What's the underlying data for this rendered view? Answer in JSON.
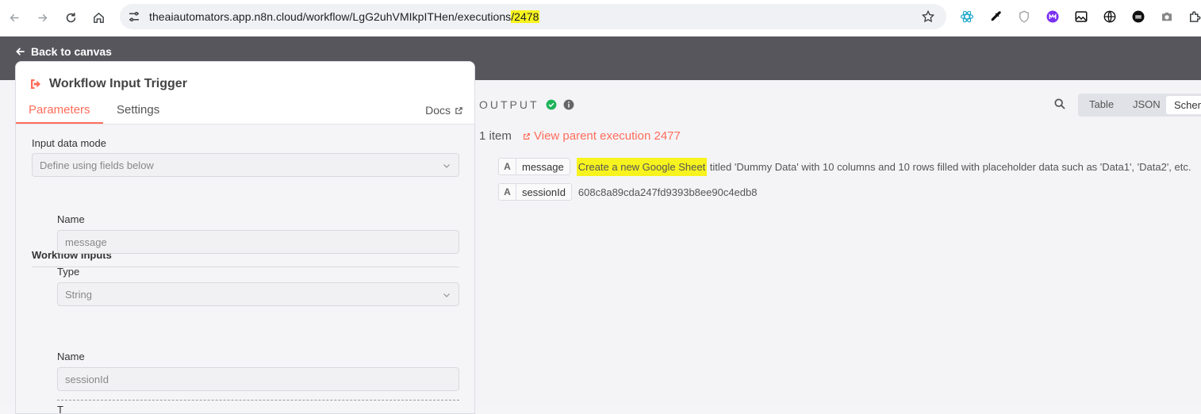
{
  "browser": {
    "url_prefix": "theaiautomators.app.n8n.cloud/workflow/LgG2uhVMIkpITHen/executions",
    "url_highlight": "/2478"
  },
  "app": {
    "back_label": "Back to canvas",
    "node_title": "Workflow Input Trigger",
    "tabs": [
      {
        "label": "Parameters"
      },
      {
        "label": "Settings"
      }
    ],
    "docs_label": "Docs",
    "params": {
      "input_mode_label": "Input data mode",
      "input_mode_value": "Define using fields below",
      "section_title": "Workflow Inputs",
      "inputs": [
        {
          "name_label": "Name",
          "name_value": "message",
          "type_label": "Type",
          "type_value": "String"
        },
        {
          "name_label": "Name",
          "name_value": "sessionId",
          "type_label": "T"
        }
      ]
    },
    "output": {
      "label": "OUTPUT",
      "views": [
        "Table",
        "JSON",
        "Schema"
      ],
      "item_count": "1 item",
      "parent_link": "View parent execution 2477",
      "rows": [
        {
          "type": "A",
          "key": "message",
          "value_highlight": "Create a new Google Sheet",
          "value_rest": " titled 'Dummy Data' with 10 columns and 10 rows filled with placeholder data such as 'Data1', 'Data2', etc."
        },
        {
          "type": "A",
          "key": "sessionId",
          "value_highlight": "",
          "value_rest": "608c8a89cda247fd9393b8ee90c4edb8"
        }
      ]
    }
  },
  "colors": {
    "accent": "#ff6d5a",
    "success": "#1fb35a",
    "highlight": "#f7f31e"
  }
}
